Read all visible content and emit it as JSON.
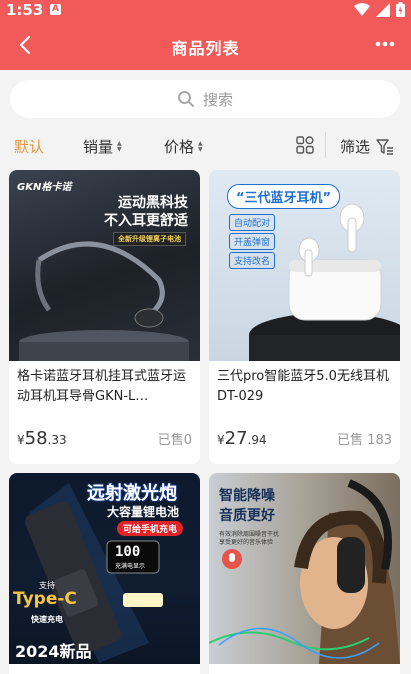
{
  "status": {
    "time": "1:53",
    "notification_letter": "A"
  },
  "header": {
    "title": "商品列表"
  },
  "search": {
    "placeholder": "搜索"
  },
  "filters": {
    "default": "默认",
    "sales": "销量",
    "price": "价格",
    "screen": "筛选"
  },
  "products": [
    {
      "name": "格卡诺蓝牙耳机挂耳式蓝牙运动耳机耳导骨GKN-L…",
      "price_symbol": "¥",
      "price_int": "58",
      "price_dec": ".33",
      "sold": "已售0",
      "image_text": {
        "brand": "GKN格卡诺",
        "line1": "运动黑科技",
        "line2": "不入耳更舒适",
        "badge": "全新升级锂离子电池"
      }
    },
    {
      "name": "三代pro智能蓝牙5.0无线耳机DT-029",
      "price_symbol": "¥",
      "price_int": "27",
      "price_dec": ".94",
      "sold": "已售 183",
      "image_text": {
        "headline": "“三代蓝牙耳机”",
        "tag1": "自动配对",
        "tag2": "开盖弹窗",
        "tag3": "支持改名"
      }
    },
    {
      "image_text": {
        "line1": "远射激光炮",
        "line2": "大容量锂电池",
        "badge": "可给手机充电",
        "battery": "100",
        "battery_label": "充满电显示",
        "support": "支持",
        "typec": "Type-C",
        "fast": "快速充电",
        "year": "2024新品"
      }
    },
    {
      "image_text": {
        "line1": "智能降噪",
        "line2": "音质更好",
        "desc1": "有效消除周围噪音干扰",
        "desc2": "享受更好的音乐体验"
      }
    }
  ],
  "colors": {
    "header": "#f25a5a",
    "active_filter": "#e8963a",
    "background": "#f3f3f3"
  }
}
